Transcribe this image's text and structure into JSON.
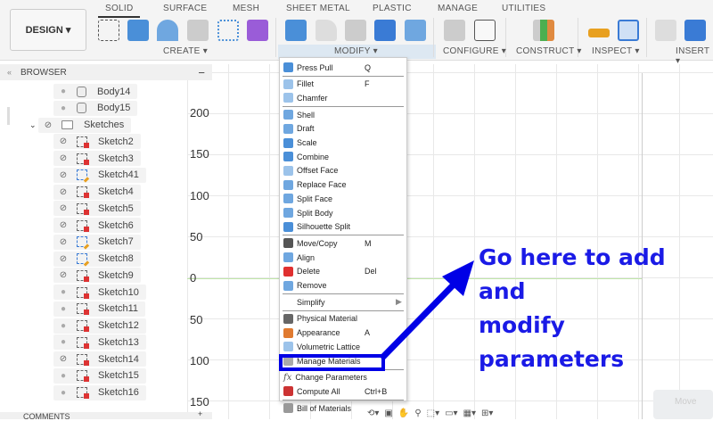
{
  "toolbar": {
    "workspace": "DESIGN ▾",
    "tabs": [
      "SOLID",
      "SURFACE",
      "MESH",
      "SHEET METAL",
      "PLASTIC",
      "MANAGE",
      "UTILITIES"
    ],
    "groups": [
      "CREATE ▾",
      "MODIFY ▾",
      "CONFIGURE ▾",
      "CONSTRUCT ▾",
      "INSPECT ▾",
      "INSERT ▾"
    ]
  },
  "browser": {
    "title": "BROWSER",
    "collapse": "−",
    "items": [
      {
        "label": "Body14",
        "type": "body",
        "visible": true,
        "indent": 1
      },
      {
        "label": "Body15",
        "type": "body",
        "visible": true,
        "indent": 1
      },
      {
        "label": "Sketches",
        "type": "folder",
        "visible": false,
        "indent": 0
      },
      {
        "label": "Sketch2",
        "type": "lock",
        "visible": false,
        "indent": 1
      },
      {
        "label": "Sketch3",
        "type": "lock",
        "visible": false,
        "indent": 1
      },
      {
        "label": "Sketch41",
        "type": "edit",
        "visible": false,
        "indent": 1
      },
      {
        "label": "Sketch4",
        "type": "lock",
        "visible": false,
        "indent": 1
      },
      {
        "label": "Sketch5",
        "type": "lock",
        "visible": false,
        "indent": 1
      },
      {
        "label": "Sketch6",
        "type": "lock",
        "visible": false,
        "indent": 1
      },
      {
        "label": "Sketch7",
        "type": "edit",
        "visible": false,
        "indent": 1
      },
      {
        "label": "Sketch8",
        "type": "edit",
        "visible": false,
        "indent": 1
      },
      {
        "label": "Sketch9",
        "type": "lock",
        "visible": false,
        "indent": 1
      },
      {
        "label": "Sketch10",
        "type": "lock",
        "visible": true,
        "indent": 1
      },
      {
        "label": "Sketch11",
        "type": "lock",
        "visible": true,
        "indent": 1
      },
      {
        "label": "Sketch12",
        "type": "lock",
        "visible": true,
        "indent": 1
      },
      {
        "label": "Sketch13",
        "type": "lock",
        "visible": true,
        "indent": 1
      },
      {
        "label": "Sketch14",
        "type": "lock",
        "visible": false,
        "indent": 1
      },
      {
        "label": "Sketch15",
        "type": "lock",
        "visible": true,
        "indent": 1
      },
      {
        "label": "Sketch16",
        "type": "lock",
        "visible": true,
        "indent": 1
      }
    ]
  },
  "canvas": {
    "y_labels": [
      "200",
      "150",
      "100",
      "50",
      "0",
      "50",
      "100",
      "150"
    ]
  },
  "menu": {
    "items": [
      {
        "label": "Press Pull",
        "shortcut": "Q",
        "color": "#4a8fd8"
      },
      {
        "sep": true
      },
      {
        "label": "Fillet",
        "shortcut": "F",
        "color": "#9cc3ea"
      },
      {
        "label": "Chamfer",
        "shortcut": "",
        "color": "#9cc3ea"
      },
      {
        "sep": true
      },
      {
        "label": "Shell",
        "shortcut": "",
        "color": "#6fa7e0"
      },
      {
        "label": "Draft",
        "shortcut": "",
        "color": "#6fa7e0"
      },
      {
        "label": "Scale",
        "shortcut": "",
        "color": "#4a8fd8"
      },
      {
        "label": "Combine",
        "shortcut": "",
        "color": "#4a8fd8"
      },
      {
        "label": "Offset Face",
        "shortcut": "",
        "color": "#9cc3ea"
      },
      {
        "label": "Replace Face",
        "shortcut": "",
        "color": "#6fa7e0"
      },
      {
        "label": "Split Face",
        "shortcut": "",
        "color": "#6fa7e0"
      },
      {
        "label": "Split Body",
        "shortcut": "",
        "color": "#6fa7e0"
      },
      {
        "label": "Silhouette Split",
        "shortcut": "",
        "color": "#4a8fd8"
      },
      {
        "sep": true
      },
      {
        "label": "Move/Copy",
        "shortcut": "M",
        "color": "#555"
      },
      {
        "label": "Align",
        "shortcut": "",
        "color": "#6fa7e0"
      },
      {
        "label": "Delete",
        "shortcut": "Del",
        "color": "#e03030"
      },
      {
        "label": "Remove",
        "shortcut": "",
        "color": "#6fa7e0"
      },
      {
        "sep": true
      },
      {
        "label": "Simplify",
        "shortcut": "▶",
        "color": "transparent"
      },
      {
        "sep": true
      },
      {
        "label": "Physical Material",
        "shortcut": "",
        "color": "#666"
      },
      {
        "label": "Appearance",
        "shortcut": "A",
        "color": "#e07a30"
      },
      {
        "label": "Volumetric Lattice",
        "shortcut": "",
        "color": "#9cc3ea"
      },
      {
        "label": "Manage Materials",
        "shortcut": "",
        "color": "#aaa"
      },
      {
        "sep": true
      },
      {
        "label": "Change Parameters",
        "shortcut": "",
        "color": "transparent",
        "fx": "fx"
      },
      {
        "label": "Compute All",
        "shortcut": "Ctrl+B",
        "color": "#c33"
      },
      {
        "sep": true
      },
      {
        "label": "Bill of Materials",
        "shortcut": "",
        "color": "#999"
      }
    ]
  },
  "annotation": {
    "line1": "Go here to add and",
    "line2": "modify parameters",
    "color": "#0000e6"
  },
  "footer": {
    "comments": "COMMENTS",
    "move": "Move"
  }
}
